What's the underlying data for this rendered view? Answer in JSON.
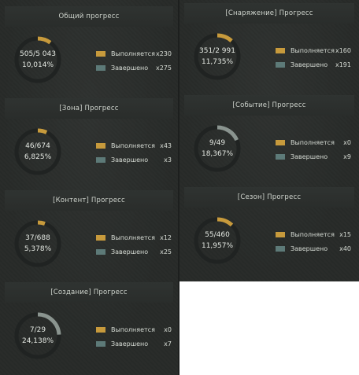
{
  "colors": {
    "in_progress": "#c79a3c",
    "completed": "#5d7a78",
    "ring_track": "#202322",
    "ring_fill_gold": "#c79a3c",
    "ring_fill_grey": "#8a948f"
  },
  "legend": {
    "in_progress_label": "Выполняется",
    "completed_label": "Завершено"
  },
  "left_column": [
    {
      "title": "Общий прогресс",
      "progress_count": "505/5 043",
      "progress_percent": "10,014%",
      "ring_fraction": 0.1,
      "ring_color": "gold",
      "in_progress_count": "x230",
      "completed_count": "x275"
    },
    {
      "title": "[Зона] Прогресс",
      "progress_count": "46/674",
      "progress_percent": "6,825%",
      "ring_fraction": 0.068,
      "ring_color": "gold",
      "in_progress_count": "x43",
      "completed_count": "x3"
    },
    {
      "title": "[Контент] Прогресс",
      "progress_count": "37/688",
      "progress_percent": "5,378%",
      "ring_fraction": 0.054,
      "ring_color": "gold",
      "in_progress_count": "x12",
      "completed_count": "x25"
    },
    {
      "title": "[Создание] Прогресс",
      "progress_count": "7/29",
      "progress_percent": "24,138%",
      "ring_fraction": 0.241,
      "ring_color": "grey",
      "in_progress_count": "x0",
      "completed_count": "x7"
    }
  ],
  "right_column": [
    {
      "title": "[Снаряжение] Прогресс",
      "progress_count": "351/2 991",
      "progress_percent": "11,735%",
      "ring_fraction": 0.117,
      "ring_color": "gold",
      "in_progress_count": "x160",
      "completed_count": "x191"
    },
    {
      "title": "[Событие] Прогресс",
      "progress_count": "9/49",
      "progress_percent": "18,367%",
      "ring_fraction": 0.184,
      "ring_color": "grey",
      "in_progress_count": "x0",
      "completed_count": "x9"
    },
    {
      "title": "[Сезон] Прогресс",
      "progress_count": "55/460",
      "progress_percent": "11,957%",
      "ring_fraction": 0.12,
      "ring_color": "gold",
      "in_progress_count": "x15",
      "completed_count": "x40"
    }
  ]
}
